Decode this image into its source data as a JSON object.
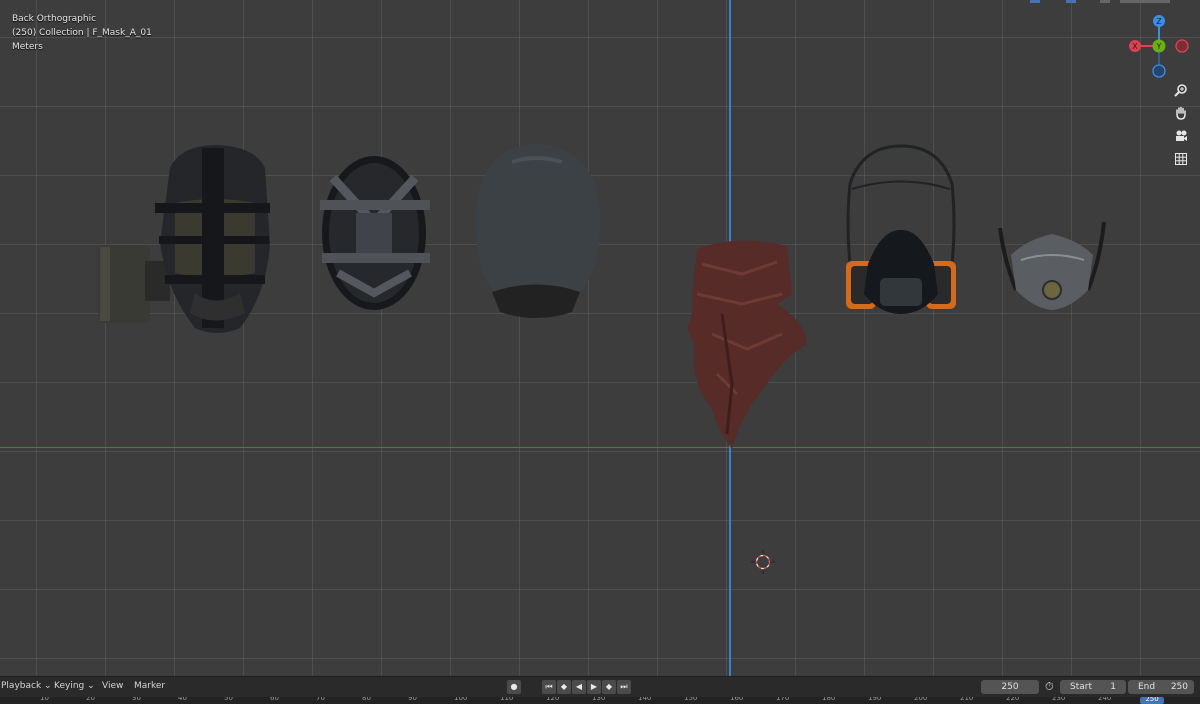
{
  "viewport": {
    "view_name": "Back Orthographic",
    "collection_line": "(250) Collection | F_Mask_A_01",
    "units": "Meters"
  },
  "gizmo": {
    "z_label": "Z",
    "y_label": "Y",
    "x_label": "X"
  },
  "nav_icons": [
    "zoom-icon",
    "hand-pan-icon",
    "camera-icon",
    "grid-icon"
  ],
  "timeline": {
    "playback_label": "Playback",
    "keying_label": "Keying",
    "view_label": "View",
    "marker_label": "Marker",
    "current_frame": "250",
    "start_label": "Start",
    "start_value": "1",
    "end_label": "End",
    "end_value": "250"
  },
  "ruler_ticks": [
    "10",
    "20",
    "30",
    "40",
    "50",
    "60",
    "70",
    "80",
    "90",
    "100",
    "110",
    "120",
    "130",
    "140",
    "150",
    "160",
    "170",
    "180",
    "190",
    "200",
    "210",
    "220",
    "230",
    "240"
  ],
  "ruler_current": "250",
  "colors": {
    "grid_bg": "#3d3d3d",
    "x_axis": "#a34d55",
    "z_axis": "#3c7fd0",
    "gizmo_x": "#e0404f",
    "gizmo_y": "#6ab015",
    "gizmo_z": "#3a8ee6",
    "accent": "#4772b3"
  }
}
